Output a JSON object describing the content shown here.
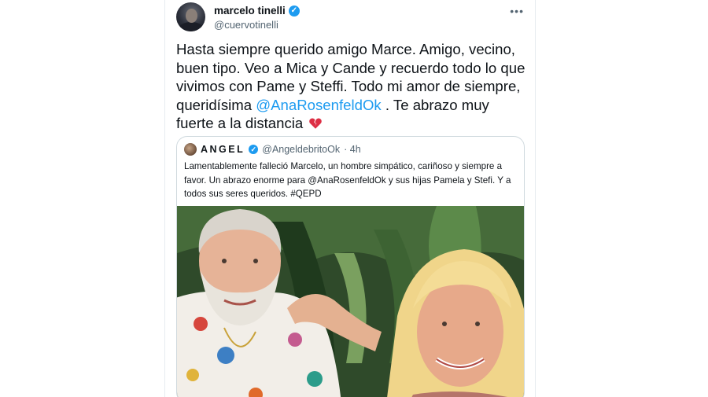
{
  "tweet": {
    "author": "marcelo tinelli",
    "handle": "@cuervotinelli",
    "text_before_mention": "Hasta siempre querido amigo Marce. Amigo, vecino, buen tipo. Veo a Mica y Cande y recuerdo todo lo que vivimos con Pame y Steffi. Todo mi amor de siempre, queridísima ",
    "mention": "@AnaRosenfeldOk",
    "text_after_mention": " . Te abrazo muy fuerte a la distancia",
    "emoji": "broken-heart-icon",
    "more_label": "•••"
  },
  "quote": {
    "name": "ANGEL",
    "handle": "@AngeldebritoOk",
    "time": "· 4h",
    "text": "Lamentablemente falleció Marcelo, un hombre simpático, cariñoso y siempre a favor. Un abrazo enorme para @AnaRosenfeldOk y sus hijas Pamela y Stefi. Y a todos sus seres queridos. #QEPD"
  },
  "colors": {
    "link": "#1d9bf0",
    "verified": "#1d9bf0",
    "secondary_text": "#536471",
    "border": "#cfd9de"
  }
}
